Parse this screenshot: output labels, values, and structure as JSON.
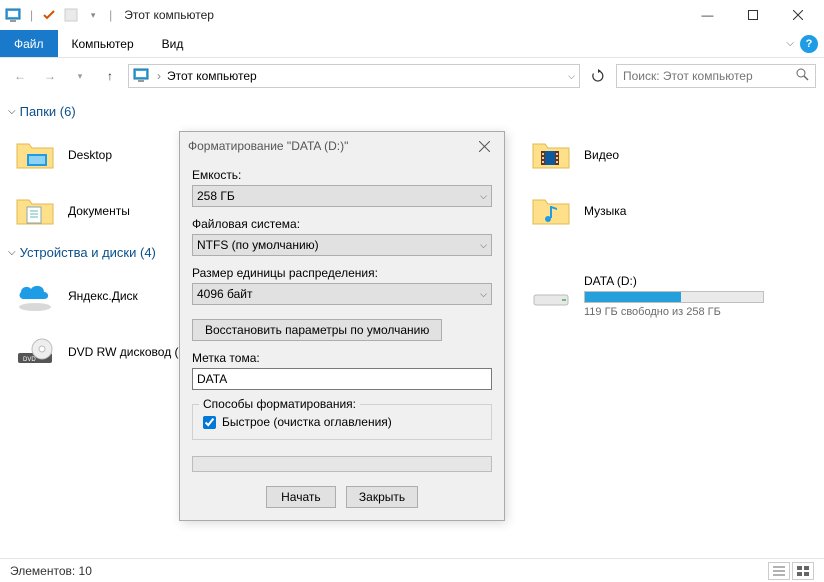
{
  "window": {
    "title": "Этот компьютер",
    "controls": {
      "min": "—",
      "max": "▢",
      "close": "✕"
    }
  },
  "menu": {
    "file": "Файл",
    "computer": "Компьютер",
    "view": "Вид"
  },
  "address": {
    "location": "Этот компьютер",
    "chevron": "›"
  },
  "search": {
    "placeholder": "Поиск: Этот компьютер"
  },
  "sections": {
    "foldersLabel": "Папки (6)",
    "devicesLabel": "Устройства и диски (4)"
  },
  "folders": {
    "desktop": "Desktop",
    "documents": "Документы",
    "video": "Видео",
    "music": "Музыка"
  },
  "devices": {
    "yandex": "Яндекс.Диск",
    "dvd": "DVD RW дисковод (G:)",
    "data": {
      "label": "DATA (D:)",
      "sub": "119 ГБ свободно из 258 ГБ",
      "fillPct": "54"
    }
  },
  "dialog": {
    "title": "Форматирование \"DATA (D:)\"",
    "capacityLabel": "Емкость:",
    "capacityValue": "258 ГБ",
    "fsLabel": "Файловая система:",
    "fsValue": "NTFS (по умолчанию)",
    "allocLabel": "Размер единицы распределения:",
    "allocValue": "4096 байт",
    "restoreBtn": "Восстановить параметры по умолчанию",
    "volumeLabel": "Метка тома:",
    "volumeValue": "DATA",
    "methodsLegend": "Способы форматирования:",
    "quickFormat": "Быстрое (очистка оглавления)",
    "start": "Начать",
    "close": "Закрыть"
  },
  "status": {
    "elements": "Элементов: 10"
  }
}
